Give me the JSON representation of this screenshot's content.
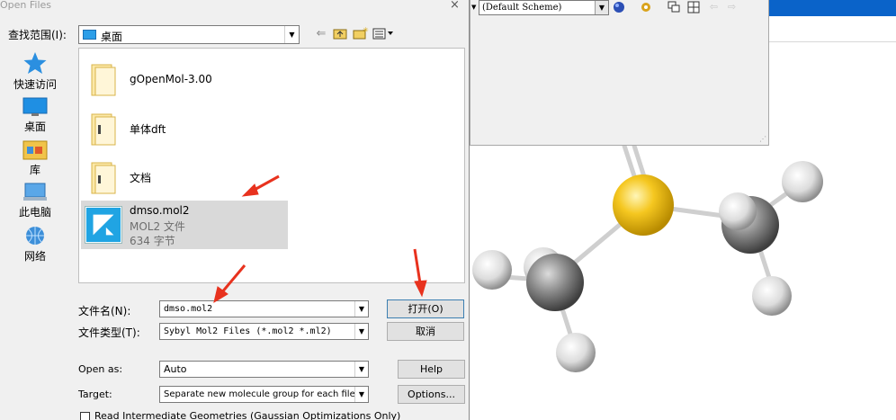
{
  "dialog": {
    "title": "Open Files",
    "close_glyph": "×",
    "lookin_label": "查找范围(I):",
    "lookin_value": "桌面",
    "places": [
      {
        "label": "快速访问",
        "icon": "star-icon"
      },
      {
        "label": "桌面",
        "icon": "desktop-icon"
      },
      {
        "label": "库",
        "icon": "library-icon"
      },
      {
        "label": "此电脑",
        "icon": "computer-icon"
      },
      {
        "label": "网络",
        "icon": "network-icon"
      }
    ],
    "files": [
      {
        "name": "gOpenMol-3.00",
        "type": "folder"
      },
      {
        "name": "单体dft",
        "type": "folder"
      },
      {
        "name": "文档",
        "type": "folder"
      },
      {
        "name": "dmso.mol2",
        "kind": "MOL2 文件",
        "size": "634 字节",
        "type": "mol2",
        "selected": true
      }
    ],
    "filename_label": "文件名(N):",
    "filename_value": "dmso.mol2",
    "filetype_label": "文件类型(T):",
    "filetype_value": "Sybyl Mol2 Files (*.mol2 *.ml2)",
    "open_button": "打开(O)",
    "cancel_button": "取消",
    "openas_label": "Open as:",
    "openas_value": "Auto",
    "help_button": "Help",
    "target_label": "Target:",
    "target_value": "Separate new molecule group for each file",
    "options_button": "Options...",
    "checkbox_label": "Read Intermediate Geometries (Gaussian Optimizations Only)"
  },
  "toolbar": {
    "scheme_value": "(Default Scheme)"
  },
  "colors": {
    "sulfur": "#f3c51f",
    "carbon": "#8c8c8c",
    "hydrogen": "#e9e9e9",
    "arrow": "#e8321e",
    "titlebar_blue": "#0a63c9",
    "folder_icon": "#2c9ee8"
  }
}
